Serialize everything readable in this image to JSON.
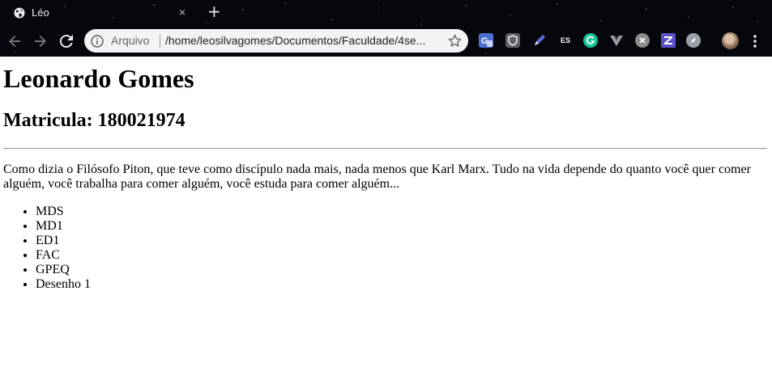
{
  "browser": {
    "tab": {
      "title": "Léo",
      "close_symbol": "×",
      "favicon": "globe-icon"
    },
    "new_tab_symbol": "+",
    "address_bar": {
      "security_chip": "Arquivo",
      "url": "/home/leosilvagomes/Documentos/Faculdade/4se..."
    },
    "extensions": [
      {
        "name": "translate-extension-icon",
        "color": "#4a6fd1"
      },
      {
        "name": "shield-extension-icon",
        "color": "#5f6368"
      },
      {
        "name": "pen-extension-icon",
        "color": "#5b6cdc"
      },
      {
        "name": "es-extension-icon",
        "label": "ES"
      },
      {
        "name": "grammarly-extension-icon",
        "color": "#15c39a"
      },
      {
        "name": "vue-devtools-extension-icon",
        "color": "#9aa0a6"
      },
      {
        "name": "x-extension-icon",
        "color": "#8a8a8a"
      },
      {
        "name": "zotero-extension-icon",
        "color": "#5b4fc9"
      },
      {
        "name": "compass-extension-icon",
        "color": "#9aa0a6"
      }
    ]
  },
  "page": {
    "heading": "Leonardo Gomes",
    "subheading": "Matricula: 180021974",
    "paragraph": "Como dizia o Filósofo Piton, que teve como discípulo nada mais, nada menos que Karl Marx. Tudo na vida depende do quanto você quer comer alguém, você trabalha para comer alguém, você estuda para comer alguém...",
    "subjects": [
      "MDS",
      "MD1",
      "ED1",
      "FAC",
      "GPEQ",
      "Desenho 1"
    ]
  }
}
